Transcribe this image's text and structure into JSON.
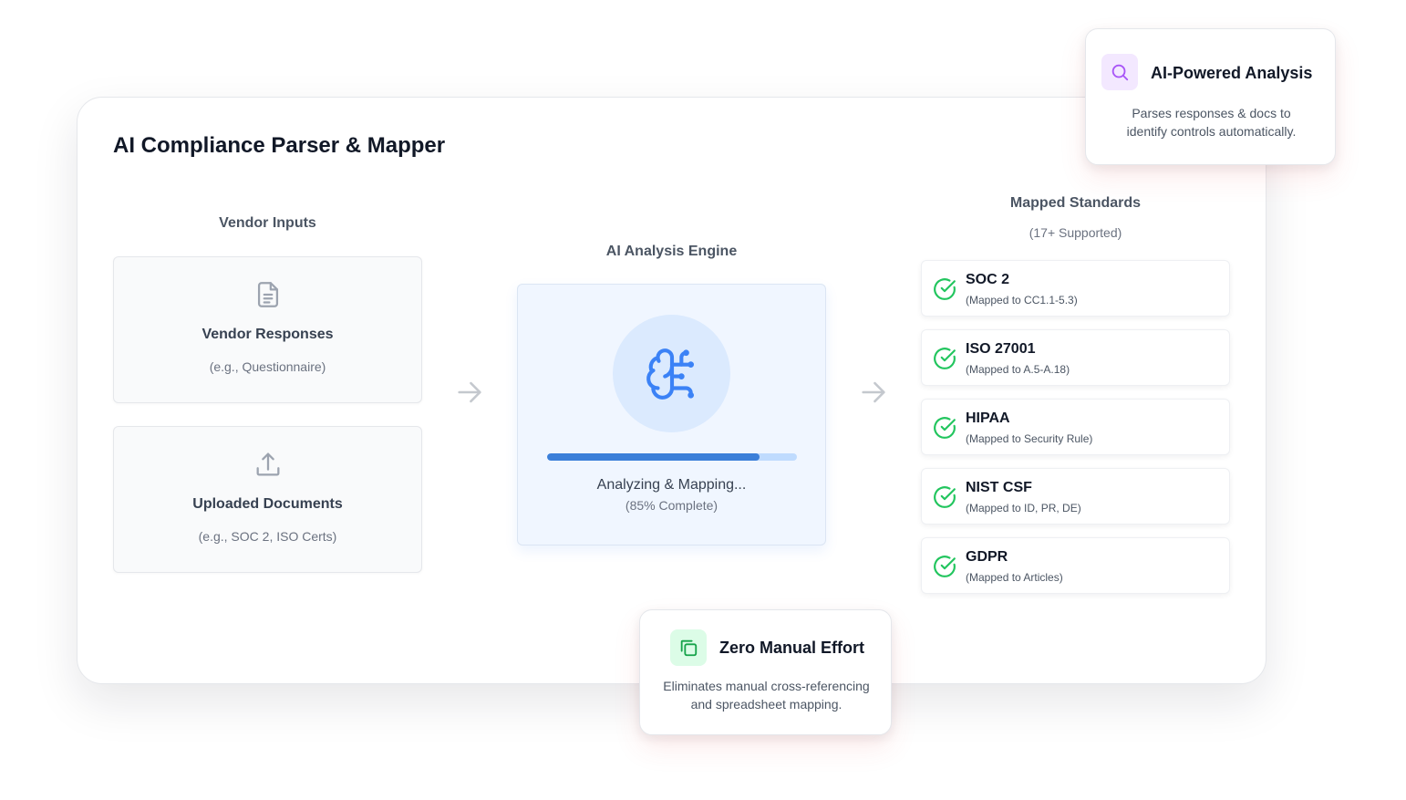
{
  "page": {
    "title": "AI Compliance Parser & Mapper"
  },
  "vendor_inputs": {
    "label": "Vendor Inputs",
    "cards": [
      {
        "icon": "document-icon",
        "title": "Vendor Responses",
        "subtitle": "(e.g., Questionnaire)"
      },
      {
        "icon": "upload-icon",
        "title": "Uploaded Documents",
        "subtitle": "(e.g., SOC 2, ISO Certs)"
      }
    ]
  },
  "engine": {
    "label": "AI Analysis Engine",
    "icon": "brain-circuit-icon",
    "progress": 0.85,
    "status": "Analyzing & Mapping...",
    "percent_text": "(85% Complete)",
    "accent": "#3b7fd9"
  },
  "standards": {
    "label": "Mapped Standards",
    "sublabel": "(17+ Supported)",
    "items": [
      {
        "name": "SOC 2",
        "mapping": "(Mapped to CC1.1-5.3)"
      },
      {
        "name": "ISO 27001",
        "mapping": "(Mapped to A.5-A.18)"
      },
      {
        "name": "HIPAA",
        "mapping": "(Mapped to Security Rule)"
      },
      {
        "name": "NIST CSF",
        "mapping": "(Mapped to ID, PR, DE)"
      },
      {
        "name": "GDPR",
        "mapping": "(Mapped to Articles)"
      }
    ],
    "check_color": "#22c55e"
  },
  "features": {
    "ai_analysis": {
      "icon": "search-icon",
      "title": "AI-Powered Analysis",
      "line1": "Parses responses & docs to",
      "line2": "identify controls automatically.",
      "accent": "#a855f7"
    },
    "zero_effort": {
      "icon": "copy-icon",
      "title": "Zero Manual Effort",
      "line1": "Eliminates manual cross-referencing",
      "line2": "and spreadsheet mapping.",
      "accent": "#16a34a"
    }
  }
}
